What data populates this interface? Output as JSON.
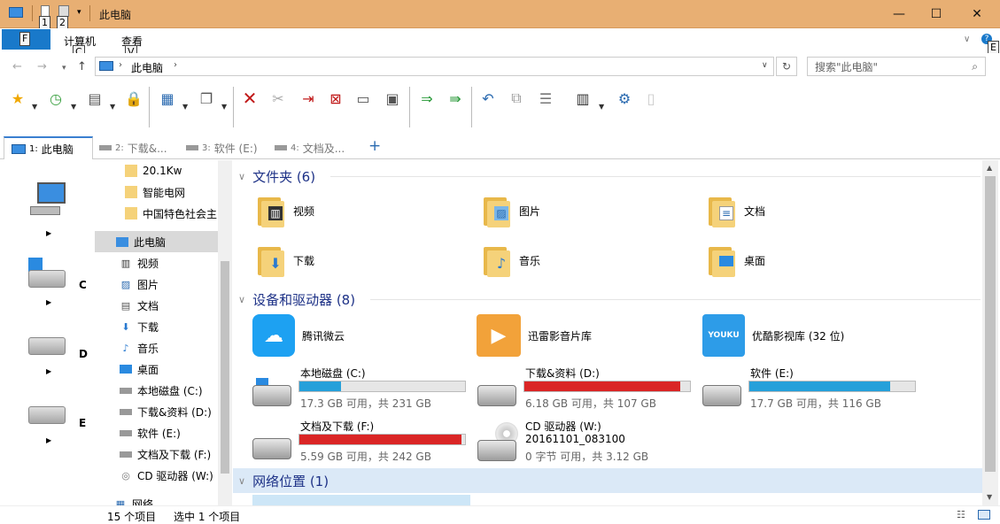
{
  "window": {
    "title": "此电脑",
    "controls": {
      "minimize": "—",
      "maximize": "☐",
      "close": "✕"
    }
  },
  "qat_keytips": [
    "1",
    "2"
  ],
  "ribbon": {
    "file_keytip": "F",
    "tabs": [
      {
        "label": "计算机",
        "keytip": "C"
      },
      {
        "label": "查看",
        "keytip": "V"
      }
    ],
    "help_keytip": "E"
  },
  "address": {
    "path": "此电脑",
    "search_placeholder": "搜索\"此电脑\""
  },
  "tabs": [
    {
      "num": "1:",
      "label": "此电脑"
    },
    {
      "num": "2:",
      "label": "下载&..."
    },
    {
      "num": "3:",
      "label": "软件 (E:)"
    },
    {
      "num": "4:",
      "label": "文档及..."
    }
  ],
  "new_tab_label": "+",
  "left_drives": [
    "C",
    "D",
    "E"
  ],
  "left_expand": "»",
  "nav": {
    "folders_top": [
      "20.1Kw",
      "智能电网",
      "中国特色社会主"
    ],
    "this_pc": "此电脑",
    "items": [
      "视频",
      "图片",
      "文档",
      "下载",
      "音乐",
      "桌面",
      "本地磁盘 (C:)",
      "下载&资料 (D:)",
      "软件 (E:)",
      "文档及下载 (F:)",
      "CD 驱动器 (W:)"
    ],
    "network": "网络"
  },
  "groups": {
    "folders": "文件夹 (6)",
    "devices": "设备和驱动器 (8)",
    "network": "网络位置 (1)"
  },
  "folders": [
    "视频",
    "图片",
    "文档",
    "下载",
    "音乐",
    "桌面"
  ],
  "apps": [
    {
      "name": "腾讯微云",
      "color": "#1da1f2"
    },
    {
      "name": "迅雷影音片库",
      "color": "#f2a23a"
    },
    {
      "name": "优酷影视库 (32 位)",
      "color": "#2d9ce8",
      "logo": "YOUKU"
    }
  ],
  "drives": [
    {
      "name": "本地磁盘 (C:)",
      "free": "17.3 GB 可用，共 231 GB",
      "used_fraction": 0.25,
      "color": "#26a0da"
    },
    {
      "name": "下载&资料 (D:)",
      "free": "6.18 GB 可用，共 107 GB",
      "used_fraction": 0.94,
      "color": "#da2626"
    },
    {
      "name": "软件 (E:)",
      "free": "17.7 GB 可用，共 116 GB",
      "used_fraction": 0.85,
      "color": "#26a0da"
    },
    {
      "name": "文档及下载 (F:)",
      "free": "5.59 GB 可用，共 242 GB",
      "used_fraction": 0.98,
      "color": "#da2626"
    }
  ],
  "cd_drive": {
    "name": "CD 驱动器 (W:)",
    "label": "20161101_083100",
    "free": "0 字节 可用，共 3.12 GB"
  },
  "status": {
    "count": "15 个项目",
    "selected": "选中 1 个项目"
  }
}
